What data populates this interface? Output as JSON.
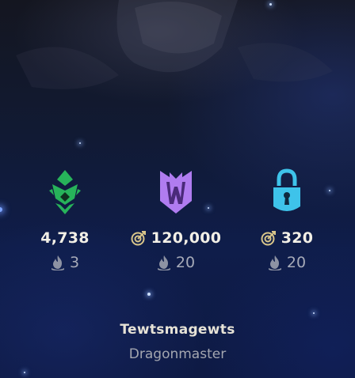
{
  "stats": [
    {
      "emblem_icon": "green-mastery-crest-icon",
      "emblem_color": "#27b35a",
      "value": "4,738",
      "value_icon": "",
      "count": "3",
      "count_icon": "flame-icon"
    },
    {
      "emblem_icon": "purple-w-crest-icon",
      "emblem_color": "#b07cf0",
      "value": "120,000",
      "value_icon": "target-icon",
      "count": "20",
      "count_icon": "flame-icon"
    },
    {
      "emblem_icon": "cyan-padlock-icon",
      "emblem_color": "#3ec3ea",
      "value": "320",
      "value_icon": "target-icon",
      "count": "20",
      "count_icon": "flame-icon"
    }
  ],
  "summoner": {
    "name": "Tewtsmagewts",
    "title": "Dragonmaster"
  },
  "colors": {
    "value_text": "#f2efe6",
    "muted_text": "#a6aab8",
    "target_icon": "#d8c58a",
    "background": "#0f1d4a"
  }
}
